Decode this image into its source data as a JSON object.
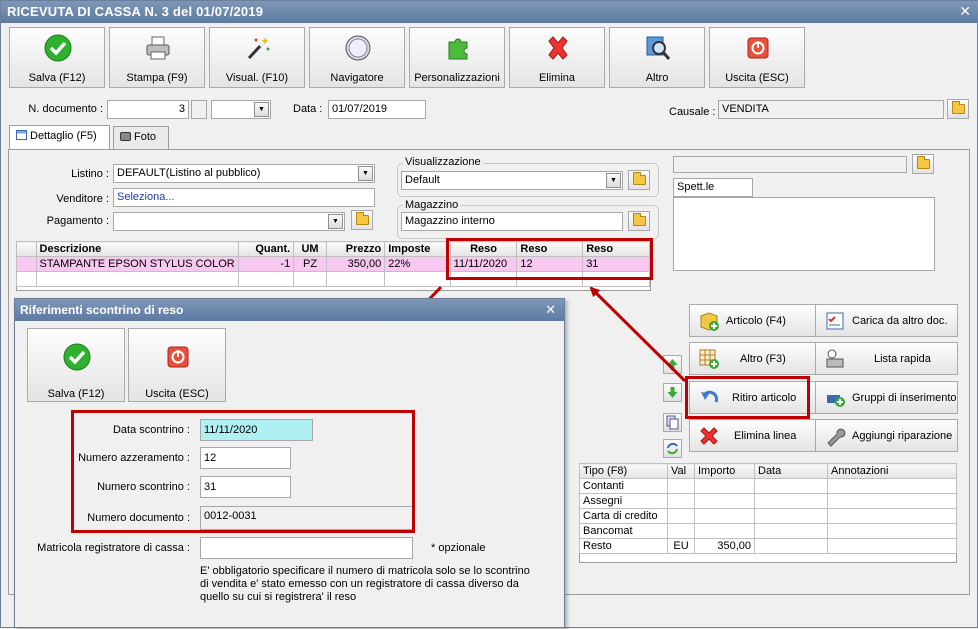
{
  "window": {
    "title": "RICEVUTA DI CASSA N. 3 del 01/07/2019",
    "close_glyph": "✕"
  },
  "toolbar": [
    {
      "label": "Salva (F12)",
      "icon": "check-icon"
    },
    {
      "label": "Stampa (F9)",
      "icon": "printer-icon"
    },
    {
      "label": "Visual. (F10)",
      "icon": "magic-wand-icon"
    },
    {
      "label": "Navigatore",
      "icon": "compass-icon"
    },
    {
      "label": "Personalizzazioni",
      "icon": "puzzle-icon"
    },
    {
      "label": "Elimina",
      "icon": "delete-x-icon"
    },
    {
      "label": "Altro",
      "icon": "magnifier-icon"
    },
    {
      "label": "Uscita (ESC)",
      "icon": "power-icon"
    }
  ],
  "header": {
    "doc_number_label": "N. documento :",
    "doc_number_value": "3",
    "date_label": "Data :",
    "date_value": "01/07/2019",
    "causale_label": "Causale :",
    "causale_value": "VENDITA"
  },
  "tabs": [
    {
      "label": "Dettaglio (F5)",
      "icon": "table-icon"
    },
    {
      "label": "Foto",
      "icon": "camera-icon"
    }
  ],
  "form": {
    "listino_label": "Listino :",
    "listino_value": "DEFAULT(Listino al pubblico)",
    "venditore_label": "Venditore :",
    "venditore_value": "Seleziona...",
    "pagamento_label": "Pagamento :",
    "pagamento_value": "",
    "visualizzazione_title": "Visualizzazione",
    "visualizzazione_value": "Default",
    "magazzino_title": "Magazzino",
    "magazzino_value": "Magazzino interno",
    "customer_value": "",
    "spett_value": "Spett.le"
  },
  "grid": {
    "headers": [
      "Descrizione",
      "Quant.",
      "UM",
      "Prezzo",
      "Imposte",
      "Reso",
      "Reso",
      "Reso"
    ],
    "row": [
      "STAMPANTE EPSON STYLUS COLOR",
      "-1",
      "PZ",
      "350,00",
      "22%",
      "11/11/2020",
      "12",
      "31"
    ]
  },
  "right_buttons": [
    {
      "label": "Articolo (F4)",
      "icon": "add-box-icon"
    },
    {
      "label": "Carica da altro doc.",
      "icon": "checklist-icon"
    },
    {
      "label": "Altro (F3)",
      "icon": "grid-add-icon"
    },
    {
      "label": "Lista rapida",
      "icon": "list-icon"
    },
    {
      "label": "Ritiro articolo",
      "icon": "return-arrow-icon"
    },
    {
      "label": "Gruppi di inserimento",
      "icon": "group-insert-icon"
    },
    {
      "label": "Elimina linea",
      "icon": "delete-x-icon"
    },
    {
      "label": "Aggiungi riparazione",
      "icon": "wrench-icon"
    }
  ],
  "payments": {
    "headers": [
      "Tipo (F8)",
      "Val",
      "Importo",
      "Data",
      "Annotazioni"
    ],
    "rows": [
      [
        "Contanti",
        "",
        "",
        "",
        ""
      ],
      [
        "Assegni",
        "",
        "",
        "",
        ""
      ],
      [
        "Carta di credito",
        "",
        "",
        "",
        ""
      ],
      [
        "Bancomat",
        "",
        "",
        "",
        ""
      ],
      [
        "Resto",
        "EU",
        "350,00",
        "",
        ""
      ]
    ]
  },
  "dialog": {
    "title": "Riferimenti scontrino di reso",
    "close_glyph": "✕",
    "save_label": "Salva (F12)",
    "exit_label": "Uscita (ESC)",
    "data_scontrino_label": "Data scontrino :",
    "data_scontrino_value": "11/11/2020",
    "azzeramento_label": "Numero azzeramento :",
    "azzeramento_value": "12",
    "scontrino_label": "Numero scontrino :",
    "scontrino_value": "31",
    "documento_label": "Numero documento :",
    "documento_value": "0012-0031",
    "matricola_label": "Matricola registratore di cassa :",
    "matricola_value": "",
    "optional_note": "* opzionale",
    "info_line1": "E' obbligatorio specificare il numero di matricola solo se lo scontrino",
    "info_line2": "di vendita e' stato emesso con un registratore di cassa diverso da",
    "info_line3": "quello su cui si registrera' il reso"
  },
  "colors": {
    "titlebar": "#6f89ad",
    "highlight": "#c00000",
    "selected_row": "#f8c8f0",
    "cyan_field": "#aff0f2"
  }
}
